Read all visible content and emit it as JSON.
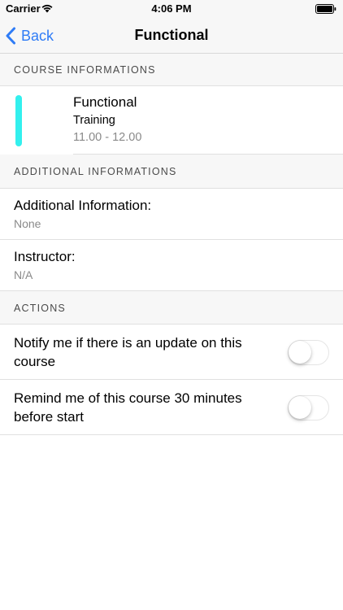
{
  "status_bar": {
    "carrier": "Carrier",
    "time": "4:06 PM",
    "wifi_icon": "wifi-icon",
    "battery_icon": "battery-full-icon"
  },
  "nav": {
    "back_label": "Back",
    "back_icon": "chevron-left-icon",
    "title": "Functional",
    "accent_color": "#2f7cf6"
  },
  "sections": {
    "course_header": "COURSE INFORMATIONS",
    "additional_header": "ADDITIONAL INFORMATIONS",
    "actions_header": "ACTIONS"
  },
  "course": {
    "name": "Functional",
    "type": "Training",
    "time": "11.00 - 12.00",
    "color": "#33f0ee"
  },
  "additional": [
    {
      "label": "Additional Information:",
      "value": "None"
    },
    {
      "label": "Instructor:",
      "value": "N/A"
    }
  ],
  "actions": [
    {
      "label": "Notify me if there is an update on this course",
      "enabled": false
    },
    {
      "label": "Remind me of this course 30 minutes before start",
      "enabled": false
    }
  ]
}
